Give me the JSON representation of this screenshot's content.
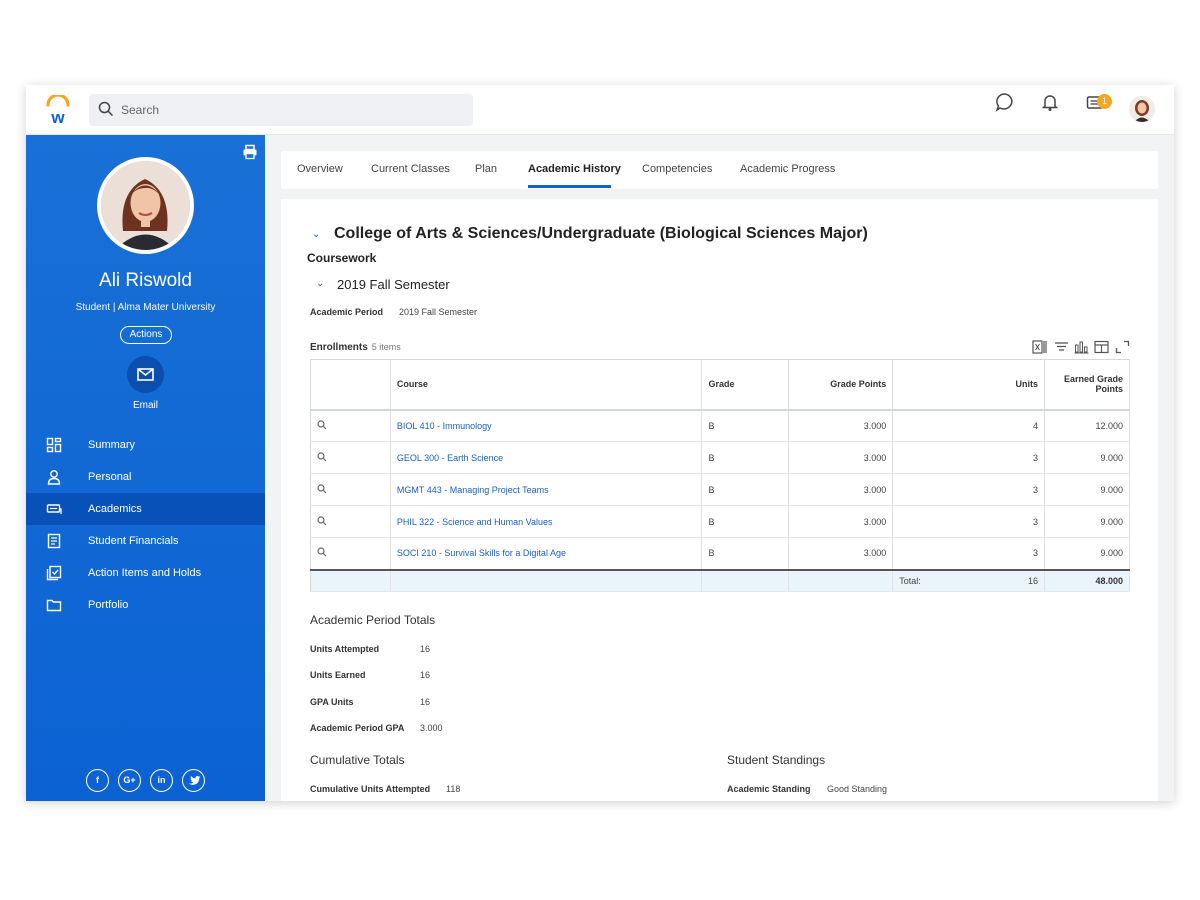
{
  "colors": {
    "brand_blue": "#0b62d3",
    "accent_orange": "#f5a623",
    "link": "#1a5fc4"
  },
  "header": {
    "search": {
      "placeholder": "Search",
      "icon": "search-icon"
    },
    "icons": [
      "chat-icon",
      "bell-icon",
      "inbox-icon"
    ],
    "inbox_badge": "1"
  },
  "sidebar": {
    "name": "Ali Riswold",
    "subtitle": "Student | Alma Mater University",
    "actions_label": "Actions",
    "email_label": "Email",
    "items": [
      {
        "label": "Summary",
        "icon": "dashboard-icon",
        "active": false
      },
      {
        "label": "Personal",
        "icon": "person-icon",
        "active": false
      },
      {
        "label": "Academics",
        "icon": "academics-icon",
        "active": true
      },
      {
        "label": "Student Financials",
        "icon": "document-icon",
        "active": false
      },
      {
        "label": "Action Items and Holds",
        "icon": "checklist-icon",
        "active": false
      },
      {
        "label": "Portfolio",
        "icon": "folder-icon",
        "active": false
      }
    ],
    "social": [
      "f",
      "G+",
      "in",
      "twitter"
    ]
  },
  "tabs": [
    {
      "label": "Overview",
      "active": false
    },
    {
      "label": "Current Classes",
      "active": false
    },
    {
      "label": "Plan",
      "active": false
    },
    {
      "label": "Academic History",
      "active": true
    },
    {
      "label": "Competencies",
      "active": false
    },
    {
      "label": "Academic Progress",
      "active": false
    }
  ],
  "main": {
    "program_title": "College of Arts & Sciences/Undergraduate (Biological Sciences Major)",
    "coursework_label": "Coursework",
    "semester_title": "2019 Fall Semester",
    "academic_period_label": "Academic Period",
    "academic_period_value": "2019 Fall Semester",
    "enrollments_label": "Enrollments",
    "enrollments_count": "5 items",
    "table": {
      "headers": [
        "",
        "Course",
        "Grade",
        "Grade Points",
        "Units",
        "Earned Grade Points"
      ],
      "rows": [
        {
          "course": "BIOL 410 - Immunology",
          "grade": "B",
          "grade_points": "3.000",
          "units": "4",
          "earned": "12.000"
        },
        {
          "course": "GEOL 300 - Earth Science",
          "grade": "B",
          "grade_points": "3.000",
          "units": "3",
          "earned": "9.000"
        },
        {
          "course": "MGMT 443 - Managing Project Teams",
          "grade": "B",
          "grade_points": "3.000",
          "units": "3",
          "earned": "9.000"
        },
        {
          "course": "PHIL 322 - Science and Human Values",
          "grade": "B",
          "grade_points": "3.000",
          "units": "3",
          "earned": "9.000"
        },
        {
          "course": "SOCI 210 - Survival Skills for a Digital Age",
          "grade": "B",
          "grade_points": "3.000",
          "units": "3",
          "earned": "9.000"
        }
      ],
      "total_label": "Total:",
      "total_units": "16",
      "total_earned": "48.000"
    },
    "period_totals": {
      "title": "Academic Period Totals",
      "items": [
        {
          "label": "Units Attempted",
          "value": "16"
        },
        {
          "label": "Units Earned",
          "value": "16"
        },
        {
          "label": "GPA Units",
          "value": "16"
        },
        {
          "label": "Academic Period GPA",
          "value": "3.000"
        }
      ]
    },
    "cumulative": {
      "title": "Cumulative Totals",
      "label": "Cumulative Units Attempted",
      "value": "118"
    },
    "standings": {
      "title": "Student Standings",
      "label": "Academic Standing",
      "value": "Good Standing"
    }
  }
}
